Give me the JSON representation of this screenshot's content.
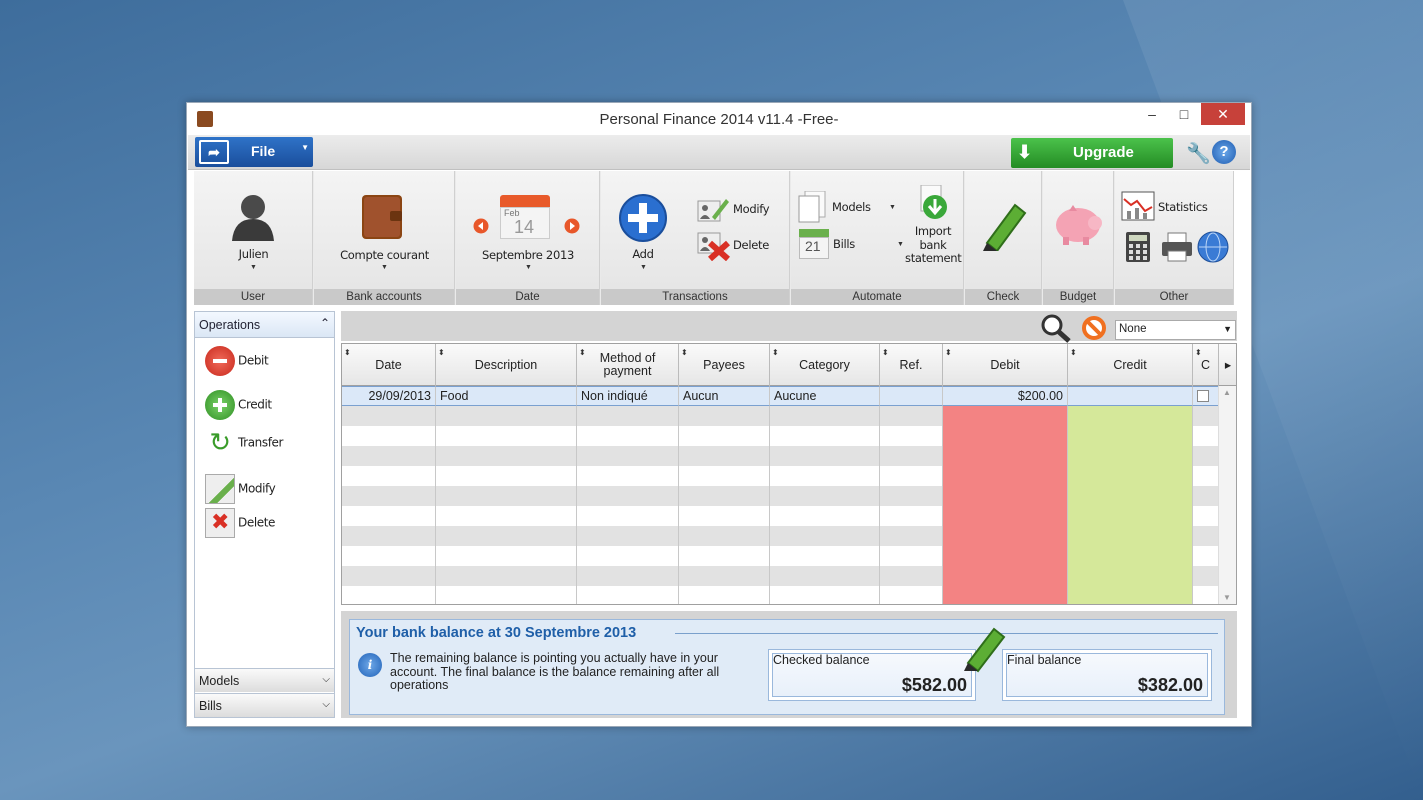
{
  "window": {
    "title": "Personal Finance 2014 v11.4 -Free-",
    "minimize": "–",
    "maximize": "□",
    "close": "✕"
  },
  "menubar": {
    "file_label": "File",
    "upgrade_label": "Upgrade",
    "help": "?"
  },
  "ribbon": {
    "user": {
      "name": "Julien",
      "group_label": "User"
    },
    "bank_accounts": {
      "account": "Compte courant",
      "group_label": "Bank accounts"
    },
    "date": {
      "month_abbr": "Feb",
      "day": "14",
      "current": "Septembre 2013",
      "group_label": "Date"
    },
    "transactions": {
      "add_label": "Add",
      "modify_label": "Modify",
      "delete_label": "Delete",
      "group_label": "Transactions"
    },
    "automate": {
      "models_label": "Models",
      "bills_label": "Bills",
      "bills_day": "21",
      "import_label": "Import bank statement",
      "group_label": "Automate"
    },
    "check": {
      "group_label": "Check"
    },
    "budget": {
      "group_label": "Budget"
    },
    "other": {
      "statistics_label": "Statistics",
      "group_label": "Other"
    }
  },
  "sidebar": {
    "header": "Operations",
    "items": [
      {
        "label": "Debit",
        "icon": "minus-circle-icon"
      },
      {
        "label": "Credit",
        "icon": "plus-circle-icon"
      },
      {
        "label": "Transfer",
        "icon": "transfer-icon"
      },
      {
        "label": "Modify",
        "icon": "modify-icon"
      },
      {
        "label": "Delete",
        "icon": "delete-icon"
      }
    ],
    "footers": [
      "Models",
      "Bills"
    ]
  },
  "filter": {
    "selected": "None"
  },
  "grid": {
    "columns": [
      "Date",
      "Description",
      "Method of payment",
      "Payees",
      "Category",
      "Ref.",
      "Debit",
      "Credit",
      "C"
    ],
    "rows": [
      {
        "date": "29/09/2013",
        "description": "Food",
        "method": "Non indiqué",
        "payee": "Aucun",
        "category": "Aucune",
        "ref": "",
        "debit": "$200.00",
        "credit": "",
        "checked": false
      }
    ],
    "debit_color": "#f38383",
    "credit_color": "#d5e89a"
  },
  "summary": {
    "title": "Your bank balance at 30 Septembre 2013",
    "text": "The remaining balance is pointing you actually have in your account. The final balance is the balance remaining after all operations",
    "checked_label": "Checked balance",
    "checked_value": "$582.00",
    "final_label": "Final balance",
    "final_value": "$382.00"
  }
}
